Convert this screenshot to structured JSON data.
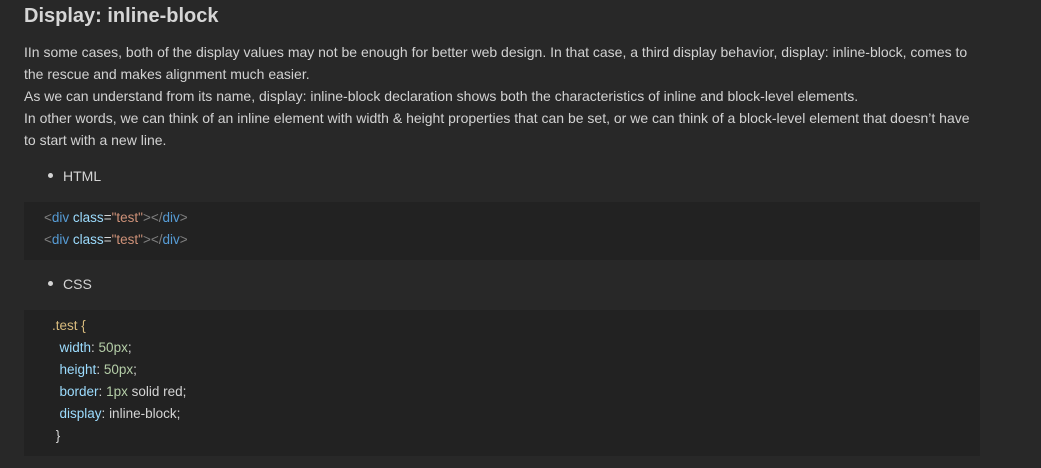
{
  "heading": "Display: inline-block",
  "paragraphs": [
    "IIn some cases, both of the display values may not be enough for better web design. In that case, a third display behavior, display: inline-block, comes to",
    "the rescue and makes alignment much easier.",
    "As we can understand from its name, display: inline-block declaration shows both the characteristics of inline and block-level elements.",
    "In other words, we can think of an inline element with width & height properties that can be set, or we can think of a block-level element that doesn’t have",
    "to start with a new line."
  ],
  "bullets": {
    "html": "HTML",
    "css": "CSS"
  },
  "html_code": {
    "lt": "<",
    "tag": "div",
    "attr": "class",
    "eq": "=",
    "value": "\"test\"",
    "close_open": ">",
    "close_tag": "</",
    "gt": ">"
  },
  "css_code": {
    "selector": ".test {",
    "width_prop": "width",
    "width_val": "50px",
    "height_prop": "height",
    "height_val": "50px",
    "border_prop": "border",
    "border_num": "1px",
    "border_rest": " solid red;",
    "display_prop": "display",
    "display_val": "inline-block;",
    "colon": ": ",
    "semi": ";",
    "close": "}"
  }
}
